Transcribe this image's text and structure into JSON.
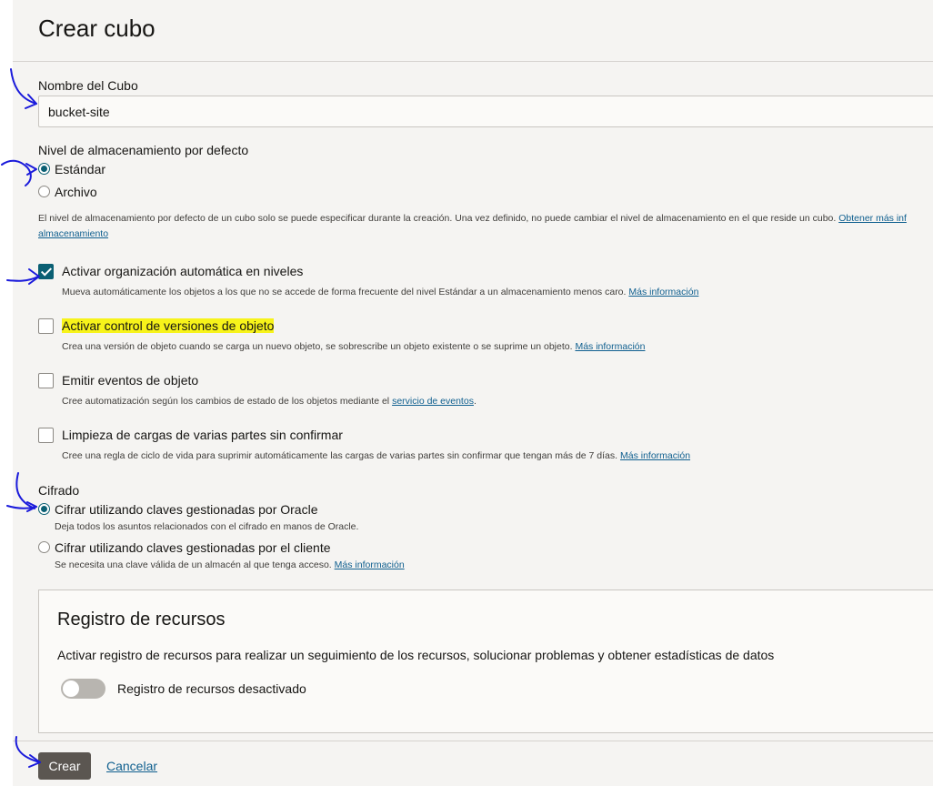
{
  "header": {
    "title": "Crear cubo"
  },
  "bucket_name": {
    "label": "Nombre del Cubo",
    "value": "bucket-site"
  },
  "storage_tier": {
    "label": "Nivel de almacenamiento por defecto",
    "options": [
      {
        "label": "Estándar",
        "checked": true
      },
      {
        "label": "Archivo",
        "checked": false
      }
    ],
    "help_text": "El nivel de almacenamiento por defecto de un cubo solo se puede especificar durante la creación. Una vez definido, no puede cambiar el nivel de almacenamiento en el que reside un cubo.",
    "help_link_part1": "Obtener más inf",
    "help_link_part2": "almacenamiento"
  },
  "options": [
    {
      "label": "Activar organización automática en niveles",
      "checked": true,
      "description": "Mueva automáticamente los objetos a los que no se accede de forma frecuente del nivel Estándar a un almacenamiento menos caro.",
      "link": "Más información"
    },
    {
      "label": "Activar control de versiones de objeto",
      "checked": false,
      "highlighted": true,
      "description": "Crea una versión de objeto cuando se carga un nuevo objeto, se sobrescribe un objeto existente o se suprime un objeto.",
      "link": "Más información"
    },
    {
      "label": "Emitir eventos de objeto",
      "checked": false,
      "description": "Cree automatización según los cambios de estado de los objetos mediante el",
      "link": "servicio de eventos",
      "suffix": "."
    },
    {
      "label": "Limpieza de cargas de varias partes sin confirmar",
      "checked": false,
      "description": "Cree una regla de ciclo de vida para suprimir automáticamente las cargas de varias partes sin confirmar que tengan más de 7 días.",
      "link": "Más información"
    }
  ],
  "encryption": {
    "label": "Cifrado",
    "options": [
      {
        "label": "Cifrar utilizando claves gestionadas por Oracle",
        "checked": true,
        "description": "Deja todos los asuntos relacionados con el cifrado en manos de Oracle."
      },
      {
        "label": "Cifrar utilizando claves gestionadas por el cliente",
        "checked": false,
        "description": "Se necesita una clave válida de un almacén al que tenga acceso.",
        "link": "Más información"
      }
    ]
  },
  "resource_logging": {
    "title": "Registro de recursos",
    "description": "Activar registro de recursos para realizar un seguimiento de los recursos, solucionar problemas y obtener estadísticas de datos",
    "toggle_label": "Registro de recursos desactivado",
    "enabled": false
  },
  "footer": {
    "create_label": "Crear",
    "cancel_label": "Cancelar"
  },
  "colors": {
    "accent": "#0a5f73",
    "link": "#0f5f8f",
    "highlight": "#f7f31a",
    "annotation": "#1a1adb"
  }
}
